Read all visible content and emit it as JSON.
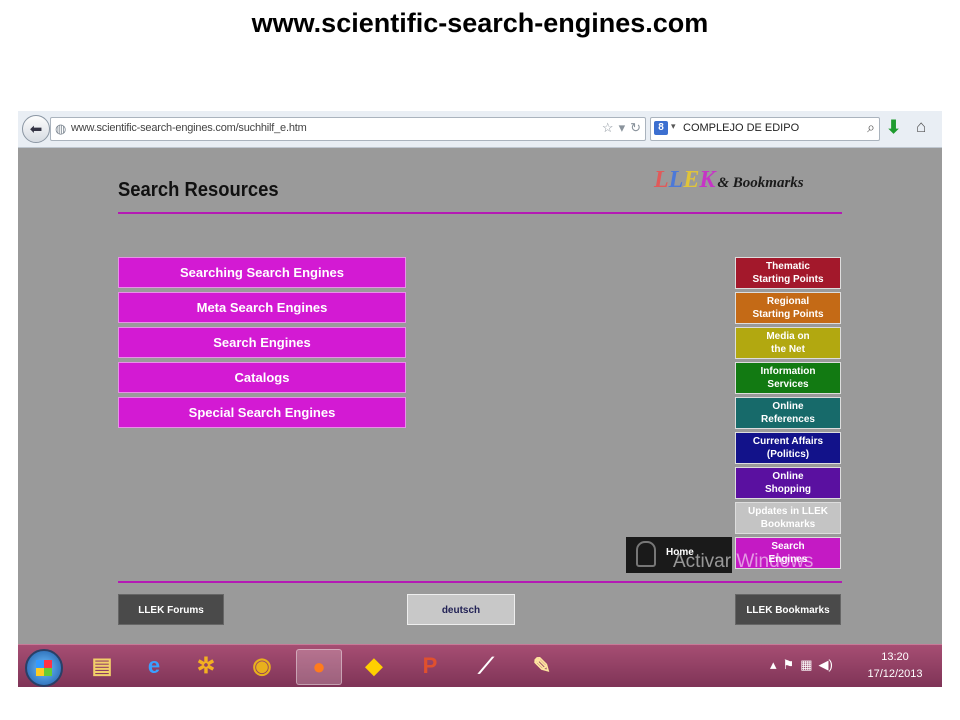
{
  "slide": {
    "title": "www.scientific-search-engines.com"
  },
  "browser": {
    "url": "www.scientific-search-engines.com/suchhilf_e.htm",
    "search_value": "COMPLEJO DE EDIPO",
    "search_engine_letter": "8"
  },
  "page": {
    "title": "Search Resources",
    "logo": {
      "l1": "L",
      "l2": "L",
      "l3": "E",
      "l4": "K",
      "tail": "& Bookmarks"
    },
    "main_menu": [
      {
        "label": "Searching Search Engines"
      },
      {
        "label": "Meta Search Engines"
      },
      {
        "label": "Search Engines"
      },
      {
        "label": "Catalogs"
      },
      {
        "label": "Special Search Engines"
      }
    ],
    "side_menu": [
      {
        "label": "Thematic\nStarting Points",
        "color": "#a3182b"
      },
      {
        "label": "Regional\nStarting Points",
        "color": "#c46a16"
      },
      {
        "label": "Media on\nthe Net",
        "color": "#b2a810"
      },
      {
        "label": "Information\nServices",
        "color": "#127a12"
      },
      {
        "label": "Online\nReferences",
        "color": "#176a6a"
      },
      {
        "label": "Current Affairs\n(Politics)",
        "color": "#12128a"
      },
      {
        "label": "Online\nShopping",
        "color": "#5a10a0"
      },
      {
        "label": "Updates in LLEK\nBookmarks",
        "color": "#c4c4c4"
      },
      {
        "label": "Search\nEngines",
        "color": "#c41ac4"
      }
    ],
    "home_label": "Home",
    "forums_label": "LLEK Forums",
    "deutsch_label": "deutsch",
    "bookmarks_label": "LLEK Bookmarks",
    "watermark": "Activar Windows"
  },
  "taskbar": {
    "clock_time": "13:20",
    "clock_date": "17/12/2013"
  }
}
